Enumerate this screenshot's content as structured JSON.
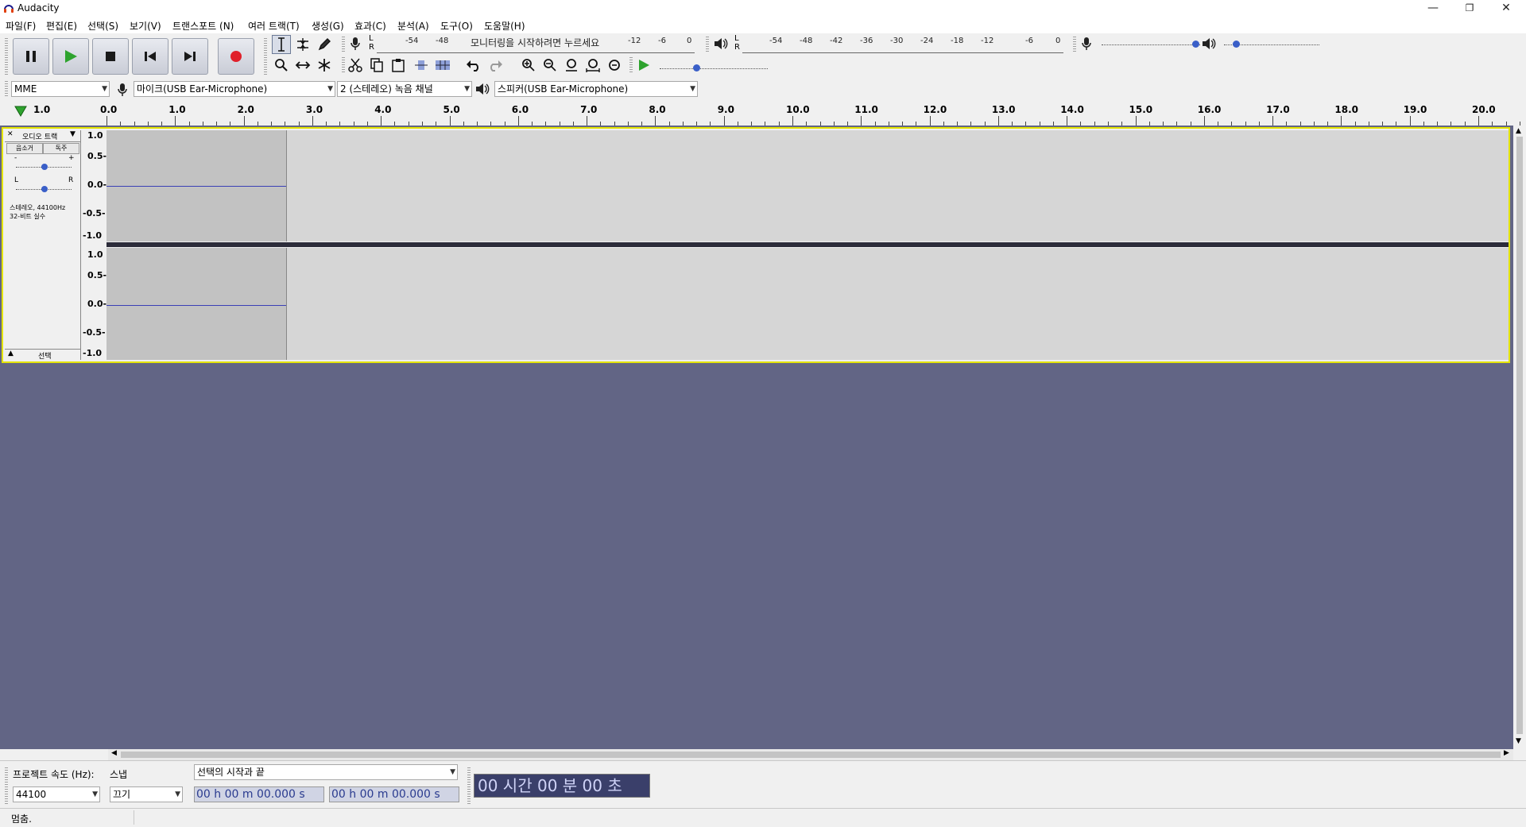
{
  "window": {
    "title": "Audacity"
  },
  "menu": [
    "파일(F)",
    "편집(E)",
    "선택(S)",
    "보기(V)",
    "트랜스포트 (N)",
    "여러 트랙(T)",
    "생성(G)",
    "효과(C)",
    "분석(A)",
    "도구(O)",
    "도움말(H)"
  ],
  "meters": {
    "record_scale": [
      "-54",
      "-48",
      "-12",
      "-6",
      "0"
    ],
    "record_prompt": "모니터링을 시작하려면 누르세요",
    "play_scale": [
      "-54",
      "-48",
      "-42",
      "-36",
      "-30",
      "-24",
      "-18",
      "-12",
      "-6",
      "0"
    ],
    "lr": [
      "L",
      "R"
    ]
  },
  "devices": {
    "host": "MME",
    "mic": "마이크(USB Ear-Microphone)",
    "channels": "2 (스테레오) 녹음 채널",
    "speaker": "스피커(USB Ear-Microphone)"
  },
  "ruler": {
    "start_label": "1.0",
    "labels": [
      "0.0",
      "1.0",
      "2.0",
      "3.0",
      "4.0",
      "5.0",
      "6.0",
      "7.0",
      "8.0",
      "9.0",
      "10.0",
      "11.0",
      "12.0",
      "13.0",
      "14.0",
      "15.0",
      "16.0",
      "17.0",
      "18.0",
      "19.0",
      "20.0"
    ]
  },
  "track": {
    "name": "오디오 트랙",
    "mute": "음소거",
    "solo": "독주",
    "gain_minus": "-",
    "gain_plus": "+",
    "pan_l": "L",
    "pan_r": "R",
    "info_line1": "스테레오, 44100Hz",
    "info_line2": "32-비트 실수",
    "select": "선택",
    "vscale": [
      "1.0",
      "0.5-",
      "0.0-",
      "-0.5-",
      "-1.0"
    ]
  },
  "selection": {
    "rate_label": "프로젝트 속도 (Hz):",
    "rate_value": "44100",
    "snap_label": "스냅",
    "snap_value": "끄기",
    "mode": "선택의 시작과 끝",
    "start_time": "00 h 00 m 00.000 s",
    "end_time": "00 h 00 m 00.000 s",
    "big_time": "00 시간 00 분 00 초"
  },
  "status": {
    "text": "멈춤."
  }
}
